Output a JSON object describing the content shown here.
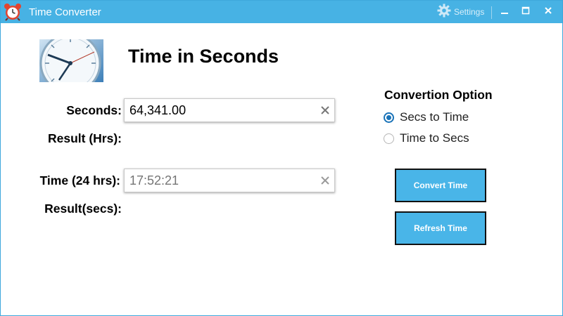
{
  "window": {
    "title": "Time Converter",
    "settings_label": "Settings"
  },
  "header": {
    "title": "Time in Seconds"
  },
  "form": {
    "seconds_label": "Seconds:",
    "seconds_value": "64,341.00",
    "result_hrs_label": "Result (Hrs):",
    "time_label": "Time (24 hrs):",
    "time_placeholder": "17:52:21",
    "result_secs_label": "Result(secs):"
  },
  "options": {
    "title": "Convertion Option",
    "items": [
      {
        "label": "Secs to Time",
        "checked": true
      },
      {
        "label": "Time to Secs",
        "checked": false
      }
    ]
  },
  "buttons": {
    "convert": "Convert Time",
    "refresh": "Refresh Time"
  },
  "colors": {
    "titlebar": "#47b2e4",
    "button": "#49b5e8",
    "radio": "#1a73b8"
  }
}
